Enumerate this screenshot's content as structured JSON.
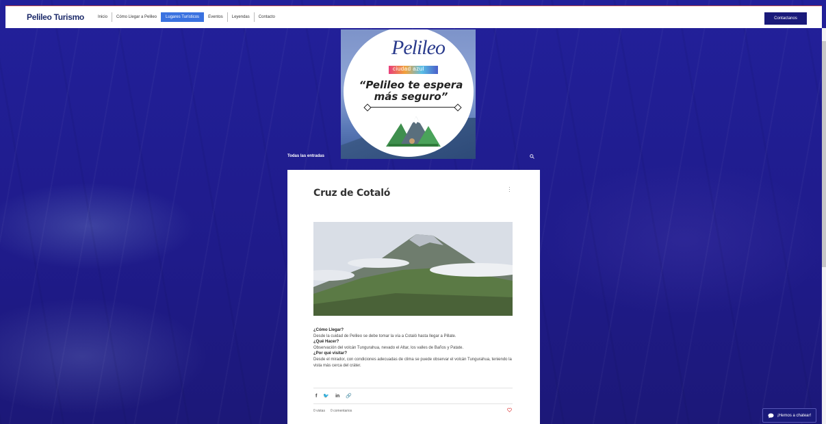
{
  "site": {
    "brand": "Pelileo Turismo"
  },
  "nav": {
    "items": [
      {
        "label": "Inicio",
        "active": false
      },
      {
        "label": "Cómo Llegar a Pelileo",
        "active": false
      },
      {
        "label": "Lugares Turísticos",
        "active": true
      },
      {
        "label": "Eventos",
        "active": false
      },
      {
        "label": "Leyendas",
        "active": false
      },
      {
        "label": "Contacto",
        "active": false
      }
    ],
    "cta_label": "Contactanos"
  },
  "hero": {
    "logo_text": "Pelileo",
    "logo_sub": "ciudad azul",
    "slogan_line1": "“Pelileo te espera",
    "slogan_line2": "más seguro”"
  },
  "blog": {
    "all_posts_label": "Todas las entradas"
  },
  "post": {
    "title": "Cruz de Cotaló",
    "q1": "¿Cómo  Llegar?",
    "a1": "Desde la cuidad de Pelileo se debe  tomar la vía a Cotaló hasta llegar a Pillate.",
    "q2": "¿Qué  Hacer?",
    "a2": "Observación  del volcán Tungurahua, nevado el Altar, los valles de Baños y Patate.",
    "q3": "¿Por  qué visitar?",
    "a3": "Desde  el mirador, con condiciones adecuadas de clima se puede observar el volcán Tungurahua, teniendo la vista más cerca del cráter.",
    "share": {
      "facebook": "f",
      "twitter": "🐦",
      "linkedin": "in",
      "link": "🔗"
    },
    "views": "0 vistas",
    "comments": "0 comentarios"
  },
  "chat": {
    "label": "¡Hemos a chatear!"
  },
  "colors": {
    "accent": "#3a72e0",
    "navy": "#1a1a7a",
    "background": "#1f1c86",
    "heart": "#e05050"
  }
}
